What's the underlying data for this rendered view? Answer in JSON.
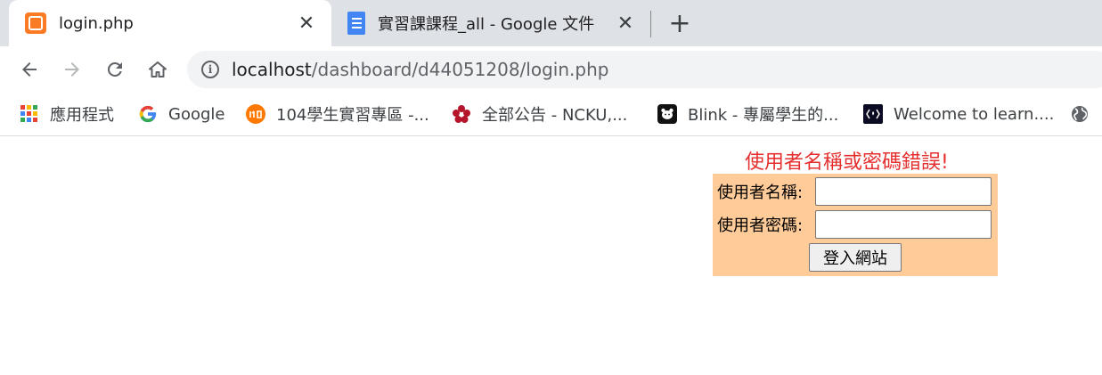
{
  "tabs": [
    {
      "title": "login.php",
      "active": true,
      "icon": "xampp-icon"
    },
    {
      "title": "實習課課程_all - Google 文件",
      "active": false,
      "icon": "google-docs-icon"
    }
  ],
  "new_tab_glyph": "+",
  "close_glyph": "✕",
  "omnibox": {
    "url_host": "localhost",
    "url_path": "/dashboard/d44051208/login.php"
  },
  "bookmarks": [
    {
      "label": "應用程式",
      "icon": "apps-grid-icon"
    },
    {
      "label": "Google",
      "icon": "google-g-icon"
    },
    {
      "label": "104學生實習專區 -...",
      "icon": "104-icon"
    },
    {
      "label": "全部公告 - NCKU,...",
      "icon": "ncku-flower-icon"
    },
    {
      "label": "Blink - 專屬學生的...",
      "icon": "bear-icon"
    },
    {
      "label": "Welcome to learn....",
      "icon": "code-icon"
    }
  ],
  "page": {
    "error_message": "使用者名稱或密碼錯誤!",
    "username_label": "使用者名稱:",
    "password_label": "使用者密碼:",
    "username_value": "",
    "password_value": "",
    "submit_label": "登入網站"
  },
  "colors": {
    "error": "#e52f2f",
    "form_background": "#ffcc99",
    "tabstrip": "#dee1e6"
  }
}
